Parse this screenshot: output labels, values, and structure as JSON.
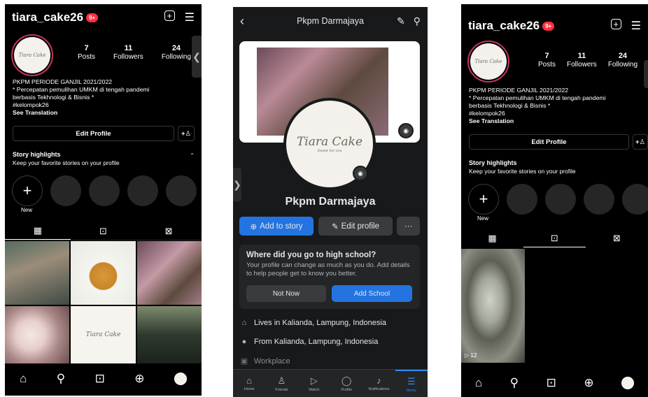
{
  "instagram": {
    "username": "tiara_cake26",
    "notif_badge": "9+",
    "avatar_text": "Tiara Cake",
    "stats": [
      {
        "value": "7",
        "label": "Posts"
      },
      {
        "value": "11",
        "label": "Followers"
      },
      {
        "value": "24",
        "label": "Following"
      }
    ],
    "bio_lines": [
      "PKPM PERIODE GANJIL 2021/2022",
      "* Percepatan pemulihan UMKM di tengah pandemi",
      "berbasis Tekhnologi & Bisnis *",
      "#kelompok26"
    ],
    "see_translation": "See Translation",
    "edit_profile": "Edit Profile",
    "story_highlights": "Story highlights",
    "story_sub": "Keep your favorite stories on your profile",
    "new_label": "New",
    "reel_views": "12"
  },
  "facebook": {
    "page_title": "Pkpm Darmajaya",
    "profile_name": "Pkpm Darmajaya",
    "logo_text": "Tiara Cake",
    "logo_sub": "Sweet for you",
    "add_story": "Add to story",
    "edit_profile": "Edit profile",
    "more": "···",
    "school_title": "Where did you go to high school?",
    "school_text": "Your profile can change as much as you do. Add details to help people get to know you better.",
    "not_now": "Not Now",
    "add_school": "Add School",
    "lives_in": "Lives in Kalianda, Lampung, Indonesia",
    "from": "From Kalianda, Lampung, Indonesia",
    "workplace": "Workplace",
    "nav": [
      "Home",
      "Friends",
      "Watch",
      "Profile",
      "Notifications",
      "Menu"
    ]
  },
  "colors": {
    "fb_blue": "#1877f2",
    "ig_badge": "#ff3040"
  }
}
